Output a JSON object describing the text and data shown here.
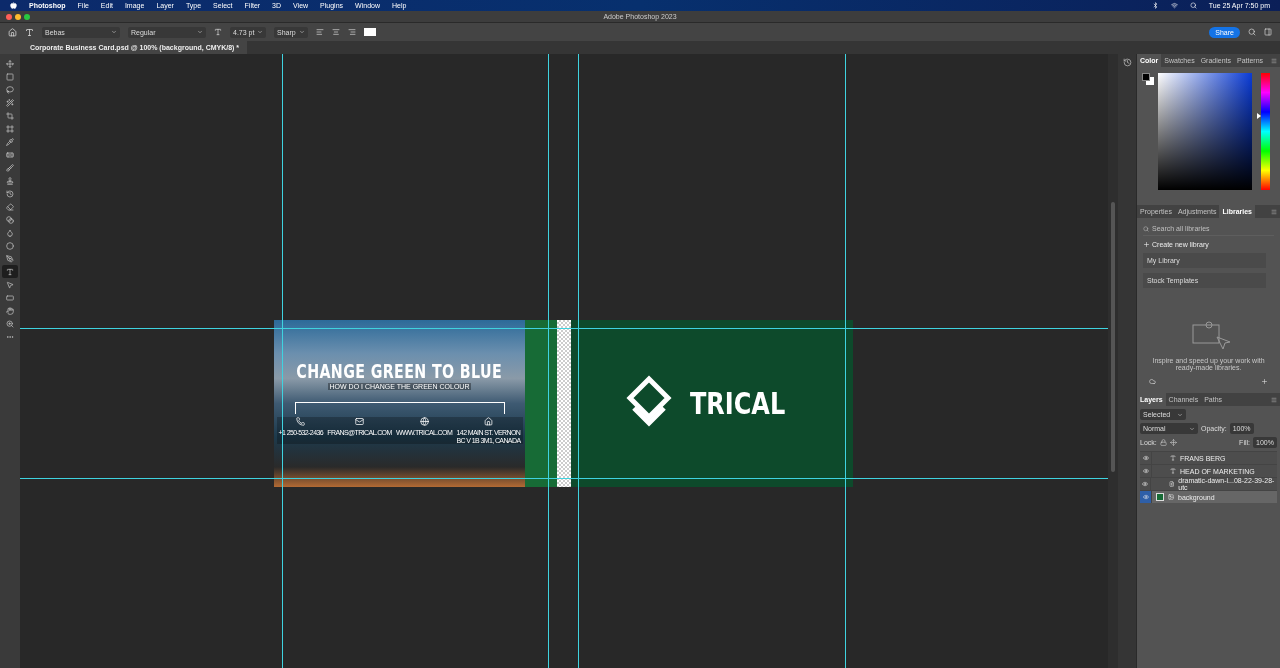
{
  "menubar": {
    "app": "Photoshop",
    "items": [
      "File",
      "Edit",
      "Image",
      "Layer",
      "Type",
      "Select",
      "Filter",
      "3D",
      "View",
      "Plugins",
      "Window",
      "Help"
    ],
    "clock": "Tue 25 Apr  7:50 pm"
  },
  "window": {
    "title": "Adobe Photoshop 2023"
  },
  "options": {
    "font": "Bebas",
    "style": "Regular",
    "size": "4.73 pt",
    "antialias": "Sharp",
    "share": "Share"
  },
  "document_tab": {
    "title": "Corporate Business Card.psd @ 100% (background, CMYK/8) *"
  },
  "tools": [
    {
      "kind": "move",
      "selected": false
    },
    {
      "kind": "marquee",
      "selected": false
    },
    {
      "kind": "lasso",
      "selected": false
    },
    {
      "kind": "select",
      "selected": false
    },
    {
      "kind": "crop",
      "selected": false
    },
    {
      "kind": "frame",
      "selected": false
    },
    {
      "kind": "eyedropper",
      "selected": false
    },
    {
      "kind": "heal",
      "selected": false
    },
    {
      "kind": "brush",
      "selected": false
    },
    {
      "kind": "stamp",
      "selected": false
    },
    {
      "kind": "history",
      "selected": false
    },
    {
      "kind": "eraser",
      "selected": false
    },
    {
      "kind": "gradient",
      "selected": false
    },
    {
      "kind": "blur",
      "selected": false
    },
    {
      "kind": "dodge",
      "selected": false
    },
    {
      "kind": "pen",
      "selected": false
    },
    {
      "kind": "type",
      "selected": true
    },
    {
      "kind": "path",
      "selected": false
    },
    {
      "kind": "shape",
      "selected": false
    },
    {
      "kind": "hand",
      "selected": false
    },
    {
      "kind": "zoom",
      "selected": false
    },
    {
      "kind": "more",
      "selected": false
    }
  ],
  "card": {
    "headline": "CHANGE GREEN TO BLUE",
    "subline": "HOW DO I CHANGE THE GREEN COLOUR",
    "contacts": [
      {
        "kind": "phone",
        "text": "+1 250-532-2436"
      },
      {
        "kind": "mail",
        "text": "FRANS@TRICAL.COM"
      },
      {
        "kind": "web",
        "text": "WWW.TRICAL.COM"
      },
      {
        "kind": "home",
        "text": "142 MAIN ST. VERNON\nBC V 1B 3M1, CANADA"
      }
    ],
    "logo": "TRICAL"
  },
  "color_panel": {
    "tabs": [
      {
        "label": "Color",
        "selected": true
      },
      {
        "label": "Swatches",
        "selected": false
      },
      {
        "label": "Gradients",
        "selected": false
      },
      {
        "label": "Patterns",
        "selected": false
      }
    ],
    "hue": {
      "level": 0.63
    }
  },
  "libraries_panel": {
    "tabs": [
      {
        "label": "Properties",
        "selected": false
      },
      {
        "label": "Adjustments",
        "selected": false
      },
      {
        "label": "Libraries",
        "selected": true
      }
    ],
    "search": {
      "placeholder": "Search all libraries"
    },
    "create": "Create new library",
    "items": [
      "My Library",
      "Stock Templates"
    ],
    "empty_message": "Inspire and speed up your work with ready-made libraries."
  },
  "layers_panel": {
    "tabs": [
      {
        "label": "Layers",
        "selected": true
      },
      {
        "label": "Channels",
        "selected": false
      },
      {
        "label": "Paths",
        "selected": false
      }
    ],
    "filter": "Selected",
    "blend": "Normal",
    "opacity_label": "Opacity:",
    "opacity": "100%",
    "lock_label": "Lock:",
    "fill_label": "Fill:",
    "fill": "100%",
    "layers": [
      {
        "kind": "text",
        "name": "FRANS BERG",
        "selected": false
      },
      {
        "kind": "text",
        "name": "HEAD  OF  MARKETING",
        "selected": false
      },
      {
        "kind": "smart",
        "name": "dramatic-dawn-l...08-22-39-28-utc",
        "selected": false
      },
      {
        "kind": "fill",
        "name": "background",
        "selected": true
      }
    ]
  }
}
